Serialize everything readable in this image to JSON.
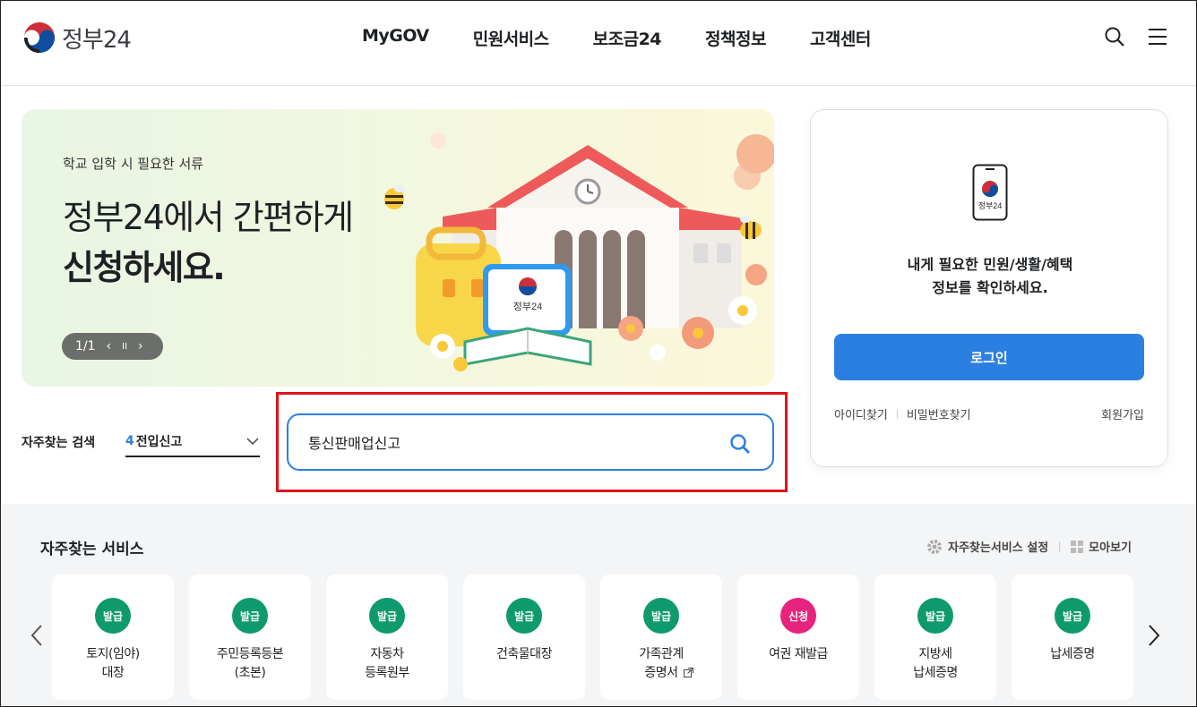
{
  "header": {
    "logo_text": "정부24",
    "nav": [
      "MyGOV",
      "민원서비스",
      "보조금24",
      "정책정보",
      "고객센터"
    ],
    "icons": [
      "search-icon",
      "hamburger-menu-icon"
    ]
  },
  "hero": {
    "subtitle": "학교 입학 시 필요한 서류",
    "title_line1": "정부24에서 간편하게",
    "title_line2": "신청하세요.",
    "pager": {
      "counter": "1/1",
      "prev": "‹",
      "pause": "II",
      "next": "›"
    },
    "illustration_label": "정부24"
  },
  "login": {
    "app_label": "정부24",
    "message_line1": "내게 필요한 민원/생활/혜택",
    "message_line2": "정보를 확인하세요.",
    "login_button": "로그인",
    "find_id": "아이디찾기",
    "find_password": "비밀번호찾기",
    "join": "회원가입"
  },
  "frequent_search": {
    "label": "자주찾는 검색",
    "selected_number": "4",
    "selected_text": "전입신고"
  },
  "search": {
    "value": "통신판매업신고"
  },
  "services": {
    "title": "자주찾는 서비스",
    "settings_label": "자주찾는서비스 설정",
    "view_all_label": "모아보기",
    "items": [
      {
        "badge": "발급",
        "label": "토지(임야)\n대장",
        "color": "#0e9a6c"
      },
      {
        "badge": "발급",
        "label": "주민등록등본\n(초본)",
        "color": "#0e9a6c"
      },
      {
        "badge": "발급",
        "label": "자동차\n등록원부",
        "color": "#0e9a6c"
      },
      {
        "badge": "발급",
        "label": "건축물대장",
        "color": "#0e9a6c"
      },
      {
        "badge": "발급",
        "label": "가족관계\n증명서",
        "color": "#0e9a6c",
        "external": true
      },
      {
        "badge": "신청",
        "label": "여권 재발급",
        "color": "#e8237d"
      },
      {
        "badge": "발급",
        "label": "지방세\n납세증명",
        "color": "#0e9a6c"
      },
      {
        "badge": "발급",
        "label": "납세증명",
        "color": "#0e9a6c"
      }
    ]
  },
  "colors": {
    "primary_blue": "#2b7fe0",
    "highlight_red": "#e0121b",
    "badge_green": "#0e9a6c",
    "badge_pink": "#e8237d"
  }
}
